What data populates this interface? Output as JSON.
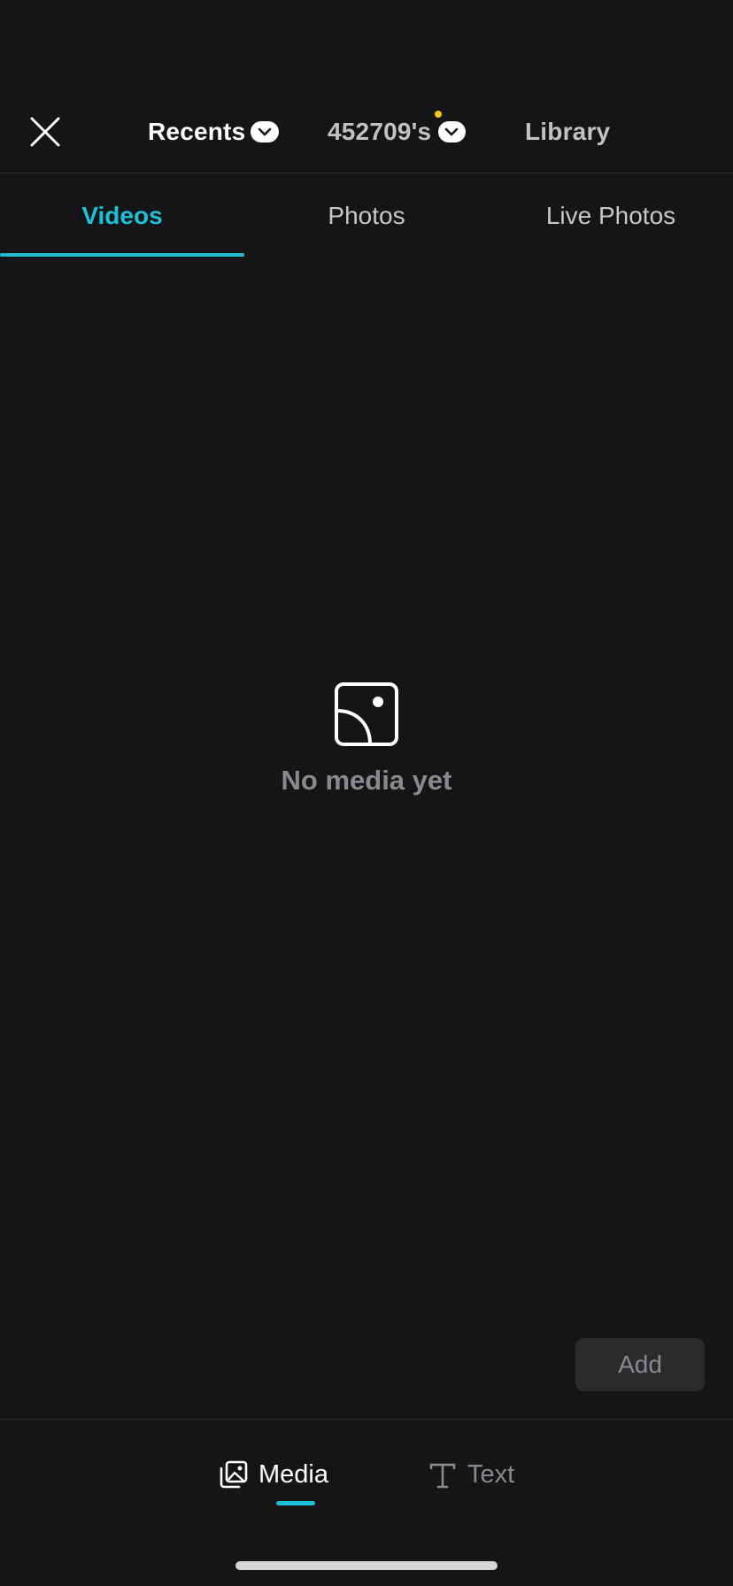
{
  "topbar": {
    "close_icon": "close-icon",
    "albums": [
      {
        "label": "Recents",
        "has_dropdown": true,
        "active": true
      },
      {
        "label": "452709's",
        "has_dropdown": true,
        "has_notification": true
      },
      {
        "label": "Library",
        "has_dropdown": false
      }
    ]
  },
  "media_type_tabs": [
    {
      "label": "Videos",
      "active": true
    },
    {
      "label": "Photos",
      "active": false
    },
    {
      "label": "Live Photos",
      "active": false
    }
  ],
  "empty_state": {
    "icon": "no-media-icon",
    "text": "No media yet"
  },
  "add_button": {
    "label": "Add",
    "enabled": false
  },
  "bottom_tabs": [
    {
      "label": "Media",
      "icon": "media-icon",
      "active": true
    },
    {
      "label": "Text",
      "icon": "text-icon",
      "active": false
    }
  ],
  "colors": {
    "background": "#151517",
    "accent": "#1ec0d6",
    "notification_dot": "#f5c518",
    "muted_text": "#8a8a8e"
  }
}
